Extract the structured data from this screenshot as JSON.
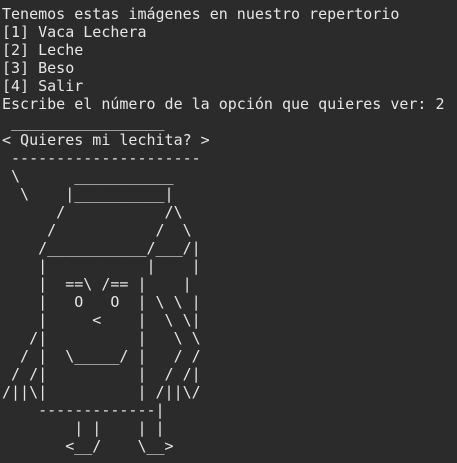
{
  "terminal": {
    "lines": [
      "Tenemos estas imágenes en nuestro repertorio",
      "[1] Vaca Lechera",
      "[2] Leche",
      "[3] Beso",
      "[4] Salir",
      "Escribe el número de la opción que quieres ver: 2"
    ],
    "ascii_art": " _________________\n< Quieres mi lechita? >\n ---------------------\n \\      ___________\n  \\    |__________|\n      /           /\\\n     /           /  \\\n    /___________/___/|\n    |           |    |\n    |  ==\\ /== |    |\n    |   O   O  | \\ \\ |\n    |     <    |  \\ \\|\n   /|          |   \\ \\\n  / |  \\_____/ |   / /\n / /|          |  / /|\n/||\\|          | /||\\/\n    -------------|\n        | |    | |\n       <__/    \\__>"
  }
}
